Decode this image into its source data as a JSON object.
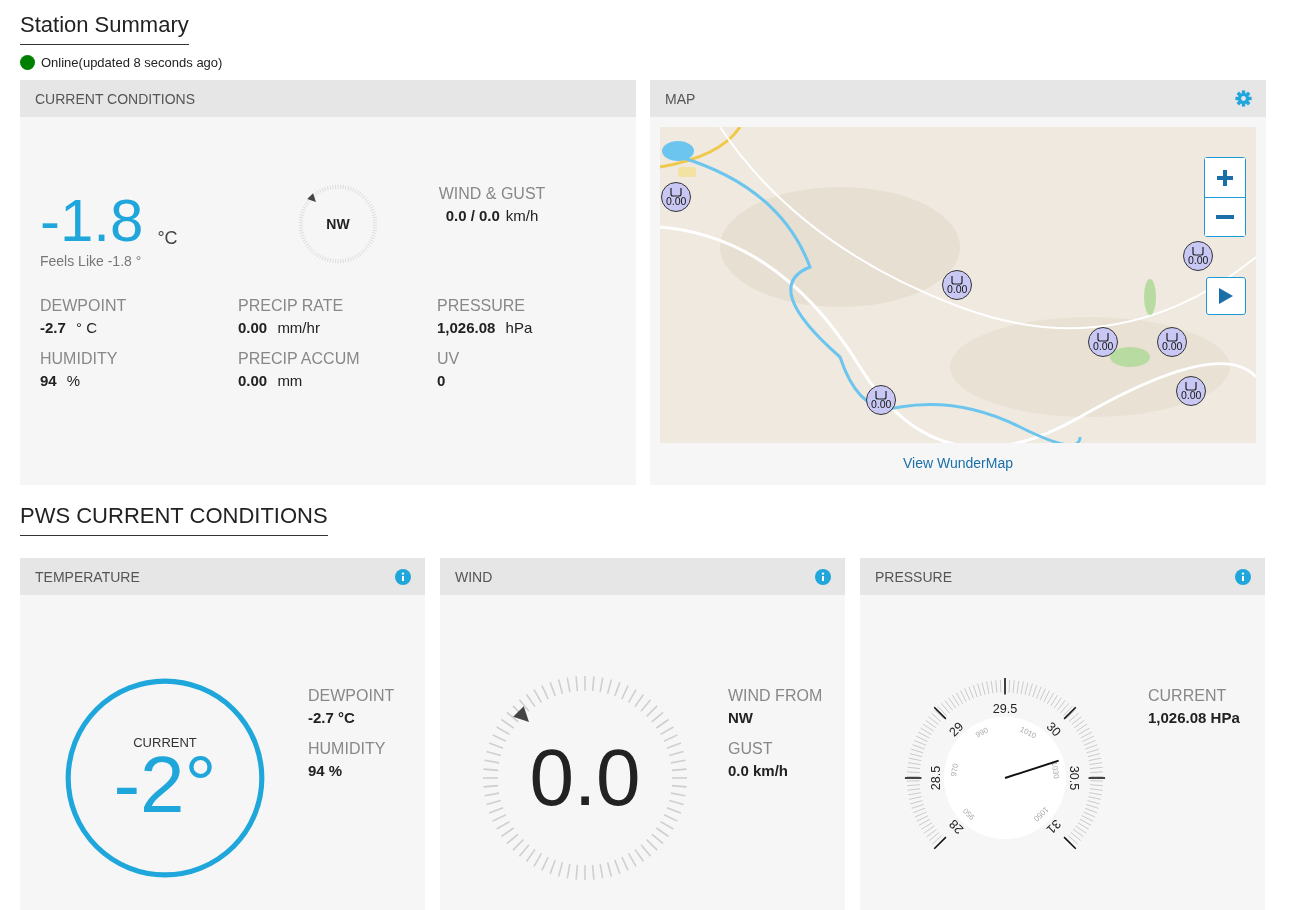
{
  "header": {
    "title": "Station Summary",
    "online": true,
    "status": "Online(updated 8 seconds ago)"
  },
  "current_conditions": {
    "title": "CURRENT CONDITIONS",
    "temperature": "-1.8",
    "temperature_unit": "°C",
    "feels_like": "Feels Like -1.8 °",
    "compass": {
      "direction": "NW",
      "pointer": {
        "kind": "northwest"
      }
    },
    "wind_gust": {
      "label": "WIND & GUST",
      "value": "0.0  / 0.0",
      "unit": "km/h"
    },
    "stats": [
      {
        "label": "DEWPOINT",
        "value": "-2.7",
        "unit": "° C"
      },
      {
        "label": "PRECIP RATE",
        "value": "0.00",
        "unit": "mm/hr"
      },
      {
        "label": "PRESSURE",
        "value": "1,026.08",
        "unit": "hPa"
      },
      {
        "label": "HUMIDITY",
        "value": "94",
        "unit": "%"
      },
      {
        "label": "PRECIP ACCUM",
        "value": "0.00",
        "unit": "mm"
      },
      {
        "label": "UV",
        "value": "0"
      }
    ]
  },
  "map": {
    "title": "MAP",
    "kind": "picture",
    "markers": [
      {
        "value": "0.00"
      },
      {
        "value": "0.00"
      },
      {
        "value": "0.00"
      },
      {
        "value": "0.00"
      },
      {
        "value": "0.00"
      },
      {
        "value": "0.00"
      },
      {
        "value": "0.00"
      }
    ],
    "link": "View WunderMap"
  },
  "pws": {
    "title": "PWS CURRENT CONDITIONS",
    "cards": [
      {
        "kind": "temperature",
        "title": "TEMPERATURE",
        "gauge_label": "CURRENT",
        "gauge_value": "-2°",
        "details": [
          {
            "label": "DEWPOINT",
            "value": "-2.7 °C"
          },
          {
            "label": "HUMIDITY",
            "value": "94 %"
          }
        ]
      },
      {
        "kind": "wind",
        "title": "WIND",
        "gauge_value": "0.0",
        "pointer": {
          "kind": "northwest"
        },
        "details": [
          {
            "label": "WIND FROM",
            "value": "NW"
          },
          {
            "label": "GUST",
            "value": "0.0 km/h"
          }
        ]
      },
      {
        "kind": "pressure",
        "title": "PRESSURE",
        "level": 0.767,
        "outer_ticks": [
          "28",
          "28.5",
          "29",
          "29.5",
          "30",
          "30.5",
          "31"
        ],
        "inner_ticks": [
          "950",
          "970",
          "990",
          "1010",
          "1030",
          "1050"
        ],
        "details": [
          {
            "label": "CURRENT",
            "value": "1,026.08 HPa"
          }
        ]
      }
    ]
  }
}
